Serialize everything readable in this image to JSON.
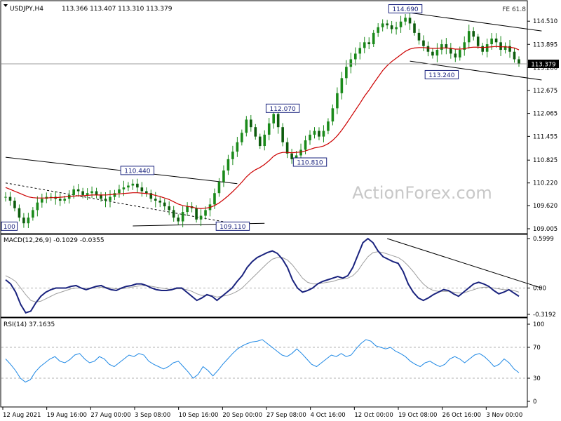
{
  "header": {
    "symbol": "USDJPY,H4",
    "ohlc": "113.366 113.407 113.310 113.379",
    "fe_label": "FE 61.8"
  },
  "watermark": "ActionForex.com",
  "colors": {
    "candle": "#1a8a1a",
    "ma": "#cc0000",
    "macd": "#1a237e",
    "signal": "#9e9e9e",
    "rsi": "#1e88e5",
    "trendline": "#000000"
  },
  "chart_data": [
    {
      "type": "candlestick",
      "panel": "price",
      "ylim": [
        109.005,
        114.7
      ],
      "yticks": [
        "114.510",
        "113.895",
        "113.280",
        "112.675",
        "112.065",
        "111.455",
        "110.825",
        "110.220",
        "109.620",
        "109.005"
      ],
      "current_price_label": "113.379",
      "current_price": 113.379,
      "annotations": [
        {
          "text": "114.690",
          "x": 88,
          "y": 114.69
        },
        {
          "text": "113.240",
          "x": 96,
          "y": 113.24
        },
        {
          "text": "112.070",
          "x": 61,
          "y": 112.07
        },
        {
          "text": "110.810",
          "x": 67,
          "y": 110.81
        },
        {
          "text": "110.440",
          "x": 29,
          "y": 110.44
        },
        {
          "text": "109.110",
          "x": 50,
          "y": 109.11
        },
        {
          "text": "100",
          "x": 0,
          "y": 109.11
        }
      ],
      "trendlines": [
        {
          "x1": 0,
          "y1": 110.9,
          "x2": 51,
          "y2": 110.2
        },
        {
          "x1": 0,
          "y1": 110.22,
          "x2": 49,
          "y2": 109.17
        },
        {
          "x1": 28,
          "y1": 109.08,
          "x2": 57,
          "y2": 109.15
        },
        {
          "x1": 88,
          "y1": 114.75,
          "x2": 118,
          "y2": 114.25
        },
        {
          "x1": 89,
          "y1": 113.45,
          "x2": 118,
          "y2": 112.95
        }
      ],
      "close": [
        109.85,
        109.75,
        109.55,
        109.3,
        109.15,
        109.3,
        109.5,
        109.7,
        109.8,
        109.85,
        109.85,
        109.8,
        109.75,
        109.8,
        109.9,
        110.05,
        110.0,
        109.9,
        109.95,
        110.0,
        109.9,
        109.8,
        109.75,
        109.85,
        109.95,
        110.05,
        110.1,
        110.15,
        110.2,
        110.1,
        110.0,
        109.95,
        109.8,
        109.75,
        109.7,
        109.6,
        109.5,
        109.3,
        109.2,
        109.45,
        109.6,
        109.55,
        109.25,
        109.35,
        109.5,
        109.65,
        109.95,
        110.25,
        110.55,
        110.85,
        111.05,
        111.3,
        111.55,
        111.9,
        111.7,
        111.45,
        111.2,
        111.5,
        111.8,
        112.05,
        111.7,
        111.3,
        111.0,
        110.85,
        110.95,
        111.1,
        111.35,
        111.5,
        111.6,
        111.45,
        111.6,
        111.85,
        112.2,
        112.6,
        113.0,
        113.3,
        113.5,
        113.65,
        113.8,
        113.95,
        113.9,
        114.2,
        114.35,
        114.45,
        114.4,
        114.3,
        114.35,
        114.5,
        114.6,
        114.45,
        114.2,
        114.0,
        113.85,
        113.7,
        113.6,
        113.75,
        113.9,
        113.8,
        113.65,
        113.55,
        113.75,
        113.95,
        114.25,
        114.1,
        113.85,
        113.7,
        113.9,
        114.05,
        113.95,
        113.75,
        113.85,
        113.7,
        113.5,
        113.379
      ],
      "ma": [
        110.1,
        110.05,
        110.0,
        109.95,
        109.9,
        109.85,
        109.83,
        109.82,
        109.82,
        109.82,
        109.83,
        109.83,
        109.84,
        109.85,
        109.86,
        109.87,
        109.88,
        109.88,
        109.89,
        109.9,
        109.9,
        109.9,
        109.9,
        109.91,
        109.92,
        109.93,
        109.94,
        109.95,
        109.96,
        109.96,
        109.95,
        109.94,
        109.92,
        109.89,
        109.86,
        109.82,
        109.78,
        109.72,
        109.66,
        109.62,
        109.6,
        109.58,
        109.55,
        109.54,
        109.55,
        109.57,
        109.62,
        109.69,
        109.78,
        109.88,
        109.99,
        110.11,
        110.24,
        110.38,
        110.49,
        110.57,
        110.63,
        110.71,
        110.81,
        110.93,
        111.0,
        111.03,
        111.03,
        111.02,
        111.03,
        111.04,
        111.07,
        111.11,
        111.15,
        111.17,
        111.2,
        111.26,
        111.35,
        111.47,
        111.62,
        111.79,
        111.97,
        112.15,
        112.33,
        112.52,
        112.68,
        112.86,
        113.03,
        113.2,
        113.33,
        113.44,
        113.53,
        113.62,
        113.71,
        113.77,
        113.8,
        113.81,
        113.81,
        113.8,
        113.79,
        113.79,
        113.8,
        113.8,
        113.79,
        113.77,
        113.77,
        113.78,
        113.81,
        113.82,
        113.82,
        113.81,
        113.82,
        113.83,
        113.84,
        113.83,
        113.83,
        113.82,
        113.8,
        113.75
      ]
    },
    {
      "type": "line",
      "panel": "macd",
      "label": "MACD(12,26,9) -0.1029 -0.0355",
      "ylim": [
        -0.3192,
        0.5999
      ],
      "yticks": [
        "0.5999",
        "0.00",
        "-0.3192"
      ],
      "trendline": {
        "x1": 84,
        "y1": 0.6,
        "x2": 118,
        "y2": 0.0
      },
      "macd": [
        0.1,
        0.05,
        -0.05,
        -0.2,
        -0.3,
        -0.28,
        -0.18,
        -0.1,
        -0.05,
        -0.02,
        0.0,
        0.0,
        0.0,
        0.02,
        0.03,
        0.0,
        -0.02,
        0.0,
        0.02,
        0.03,
        0.0,
        -0.02,
        -0.03,
        0.0,
        0.02,
        0.03,
        0.05,
        0.05,
        0.03,
        0.0,
        -0.02,
        -0.03,
        -0.03,
        -0.02,
        0.0,
        0.0,
        -0.05,
        -0.1,
        -0.15,
        -0.12,
        -0.08,
        -0.1,
        -0.15,
        -0.1,
        -0.05,
        0.0,
        0.08,
        0.15,
        0.25,
        0.32,
        0.37,
        0.4,
        0.43,
        0.45,
        0.42,
        0.35,
        0.25,
        0.1,
        0.0,
        -0.05,
        -0.03,
        0.0,
        0.05,
        0.08,
        0.1,
        0.12,
        0.14,
        0.12,
        0.15,
        0.25,
        0.4,
        0.55,
        0.6,
        0.55,
        0.45,
        0.38,
        0.35,
        0.32,
        0.3,
        0.2,
        0.05,
        -0.05,
        -0.12,
        -0.15,
        -0.12,
        -0.08,
        -0.05,
        -0.02,
        -0.03,
        -0.07,
        -0.1,
        -0.05,
        0.0,
        0.05,
        0.07,
        0.05,
        0.02,
        -0.03,
        -0.07,
        -0.05,
        -0.02,
        -0.06,
        -0.1
      ],
      "signal": [
        0.15,
        0.12,
        0.08,
        0.0,
        -0.08,
        -0.15,
        -0.17,
        -0.16,
        -0.13,
        -0.1,
        -0.07,
        -0.05,
        -0.03,
        -0.01,
        0.0,
        0.0,
        0.0,
        0.0,
        0.0,
        0.01,
        0.01,
        0.0,
        -0.01,
        -0.01,
        0.0,
        0.01,
        0.02,
        0.03,
        0.03,
        0.02,
        0.01,
        0.0,
        -0.01,
        -0.02,
        -0.01,
        -0.01,
        -0.02,
        -0.04,
        -0.07,
        -0.09,
        -0.09,
        -0.09,
        -0.11,
        -0.1,
        -0.09,
        -0.07,
        -0.04,
        0.0,
        0.06,
        0.12,
        0.18,
        0.24,
        0.3,
        0.35,
        0.37,
        0.37,
        0.34,
        0.28,
        0.2,
        0.12,
        0.07,
        0.05,
        0.05,
        0.06,
        0.07,
        0.08,
        0.1,
        0.11,
        0.12,
        0.15,
        0.21,
        0.3,
        0.38,
        0.43,
        0.44,
        0.43,
        0.41,
        0.39,
        0.37,
        0.33,
        0.27,
        0.2,
        0.12,
        0.05,
        0.0,
        -0.03,
        -0.04,
        -0.04,
        -0.04,
        -0.05,
        -0.06,
        -0.06,
        -0.04,
        -0.02,
        0.0,
        0.01,
        0.01,
        0.0,
        -0.01,
        -0.02,
        -0.02,
        -0.03,
        -0.05
      ]
    },
    {
      "type": "line",
      "panel": "rsi",
      "label": "RSI(14) 37.1635",
      "ylim": [
        0,
        100
      ],
      "yticks": [
        "100",
        "70",
        "30",
        "0"
      ],
      "levels": [
        70,
        30
      ],
      "x_labels": [
        "12 Aug 2021",
        "19 Aug 16:00",
        "27 Aug 00:00",
        "3 Sep 08:00",
        "10 Sep 16:00",
        "20 Sep 00:00",
        "27 Sep 08:00",
        "4 Oct 16:00",
        "12 Oct 00:00",
        "19 Oct 08:00",
        "26 Oct 16:00",
        "3 Nov 00:00"
      ],
      "values": [
        55,
        48,
        40,
        30,
        25,
        28,
        38,
        45,
        50,
        55,
        58,
        52,
        50,
        54,
        60,
        62,
        55,
        50,
        52,
        58,
        55,
        48,
        45,
        50,
        55,
        60,
        58,
        62,
        60,
        52,
        48,
        45,
        42,
        45,
        50,
        52,
        45,
        38,
        30,
        35,
        45,
        40,
        33,
        40,
        48,
        55,
        62,
        68,
        72,
        75,
        77,
        78,
        80,
        75,
        70,
        65,
        60,
        58,
        62,
        68,
        62,
        55,
        48,
        45,
        50,
        55,
        60,
        58,
        62,
        58,
        60,
        68,
        75,
        80,
        78,
        72,
        70,
        68,
        70,
        65,
        62,
        58,
        52,
        48,
        45,
        50,
        52,
        48,
        45,
        48,
        55,
        58,
        55,
        50,
        55,
        60,
        62,
        58,
        52,
        45,
        48,
        55,
        50,
        42,
        37.16
      ]
    }
  ]
}
